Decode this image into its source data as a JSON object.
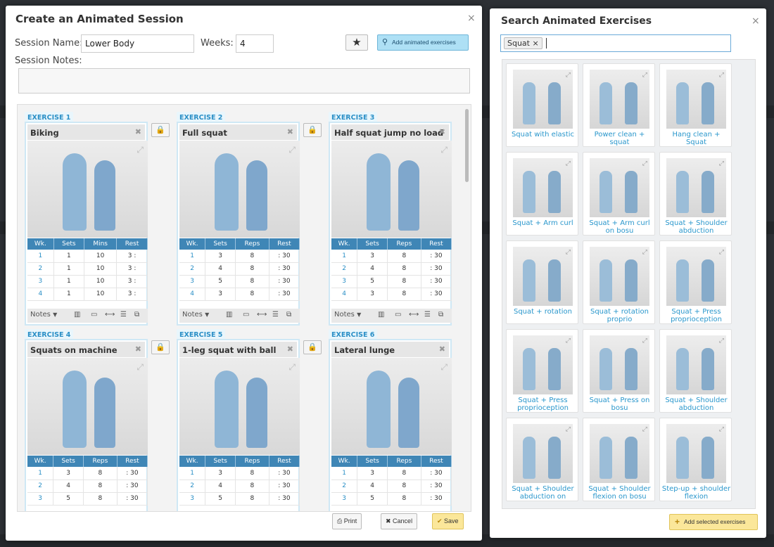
{
  "left_modal": {
    "title": "Create an Animated Session",
    "close": "×",
    "session_name_label": "Session Name:",
    "session_name_value": "Lower Body",
    "weeks_label": "Weeks:",
    "weeks_value": "4",
    "session_notes_label": "Session Notes:",
    "star": "★",
    "add_animated": "Add animated exercises",
    "exercises": [
      {
        "tag": "EXERCISE 1",
        "name": "Biking",
        "cols": [
          "Wk.",
          "Sets",
          "Mins",
          "Rest"
        ],
        "rows": [
          [
            "1",
            "1",
            "10",
            "3 :"
          ],
          [
            "2",
            "1",
            "10",
            "3 :"
          ],
          [
            "3",
            "1",
            "10",
            "3 :"
          ],
          [
            "4",
            "1",
            "10",
            "3 :"
          ]
        ]
      },
      {
        "tag": "EXERCISE 2",
        "name": "Full squat",
        "cols": [
          "Wk.",
          "Sets",
          "Reps",
          "Rest"
        ],
        "rows": [
          [
            "1",
            "3",
            "8",
            ": 30"
          ],
          [
            "2",
            "4",
            "8",
            ": 30"
          ],
          [
            "3",
            "5",
            "8",
            ": 30"
          ],
          [
            "4",
            "3",
            "8",
            ": 30"
          ]
        ]
      },
      {
        "tag": "EXERCISE 3",
        "name": "Half squat jump no load",
        "cols": [
          "Wk.",
          "Sets",
          "Reps",
          "Rest"
        ],
        "rows": [
          [
            "1",
            "3",
            "8",
            ": 30"
          ],
          [
            "2",
            "4",
            "8",
            ": 30"
          ],
          [
            "3",
            "5",
            "8",
            ": 30"
          ],
          [
            "4",
            "3",
            "8",
            ": 30"
          ]
        ]
      },
      {
        "tag": "EXERCISE 4",
        "name": "Squats on machine",
        "cols": [
          "Wk.",
          "Sets",
          "Reps",
          "Rest"
        ],
        "rows": [
          [
            "1",
            "3",
            "8",
            ": 30"
          ],
          [
            "2",
            "4",
            "8",
            ": 30"
          ],
          [
            "3",
            "5",
            "8",
            ": 30"
          ]
        ]
      },
      {
        "tag": "EXERCISE 5",
        "name": "1-leg squat with ball",
        "cols": [
          "Wk.",
          "Sets",
          "Reps",
          "Rest"
        ],
        "rows": [
          [
            "1",
            "3",
            "8",
            ": 30"
          ],
          [
            "2",
            "4",
            "8",
            ": 30"
          ],
          [
            "3",
            "5",
            "8",
            ": 30"
          ]
        ]
      },
      {
        "tag": "EXERCISE 6",
        "name": "Lateral lunge",
        "cols": [
          "Wk.",
          "Sets",
          "Reps",
          "Rest"
        ],
        "rows": [
          [
            "1",
            "3",
            "8",
            ": 30"
          ],
          [
            "2",
            "4",
            "8",
            ": 30"
          ],
          [
            "3",
            "5",
            "8",
            ": 30"
          ]
        ]
      }
    ],
    "notes_label": "Notes",
    "print": "Print",
    "cancel": "Cancel",
    "save": "Save"
  },
  "right_modal": {
    "title": "Search Animated Exercises",
    "close": "×",
    "chip": "Squat",
    "results": [
      "Squat with elastic",
      "Power clean + squat",
      "Hang clean + Squat",
      "Squat + Arm curl",
      "Squat + Arm curl on bosu",
      "Squat + Shoulder abduction",
      "Squat + rotation",
      "Squat + rotation proprio",
      "Squat + Press proprioception",
      "Squat + Press proprioception",
      "Squat + Press on bosu",
      "Squat + Shoulder abduction",
      "Squat + Shoulder abduction on",
      "Squat + Shoulder flexion on bosu",
      "Step-up + shoulder flexion"
    ],
    "add_selected": "Add selected exercises"
  },
  "colors": {
    "accent": "#3f86b6",
    "link": "#2a97cc",
    "save": "#fbe79a"
  }
}
